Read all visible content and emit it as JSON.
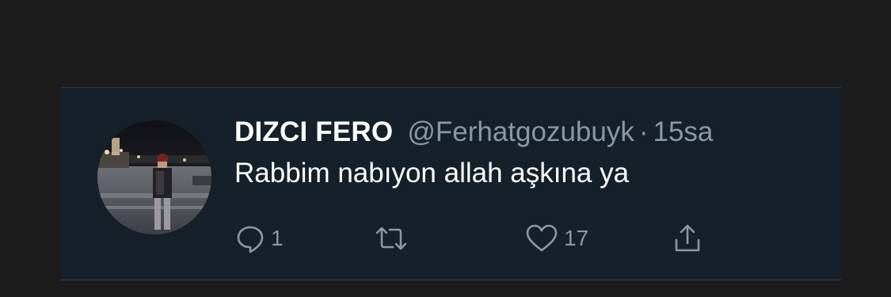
{
  "tweet": {
    "display_name": "DIZCI FERO",
    "handle": "@Ferhatgozubuyk",
    "separator": "·",
    "time": "15sa",
    "text": "Rabbim nabıyon allah aşkına ya"
  },
  "actions": {
    "reply_count": "1",
    "like_count": "17"
  },
  "icons": {
    "reply": "reply-icon",
    "retweet": "retweet-icon",
    "like": "heart-icon",
    "share": "share-icon"
  },
  "colors": {
    "page_background": "#1c1c1c",
    "card_background": "#15202b",
    "primary_text": "#ffffff",
    "secondary_text": "#8899a6"
  }
}
